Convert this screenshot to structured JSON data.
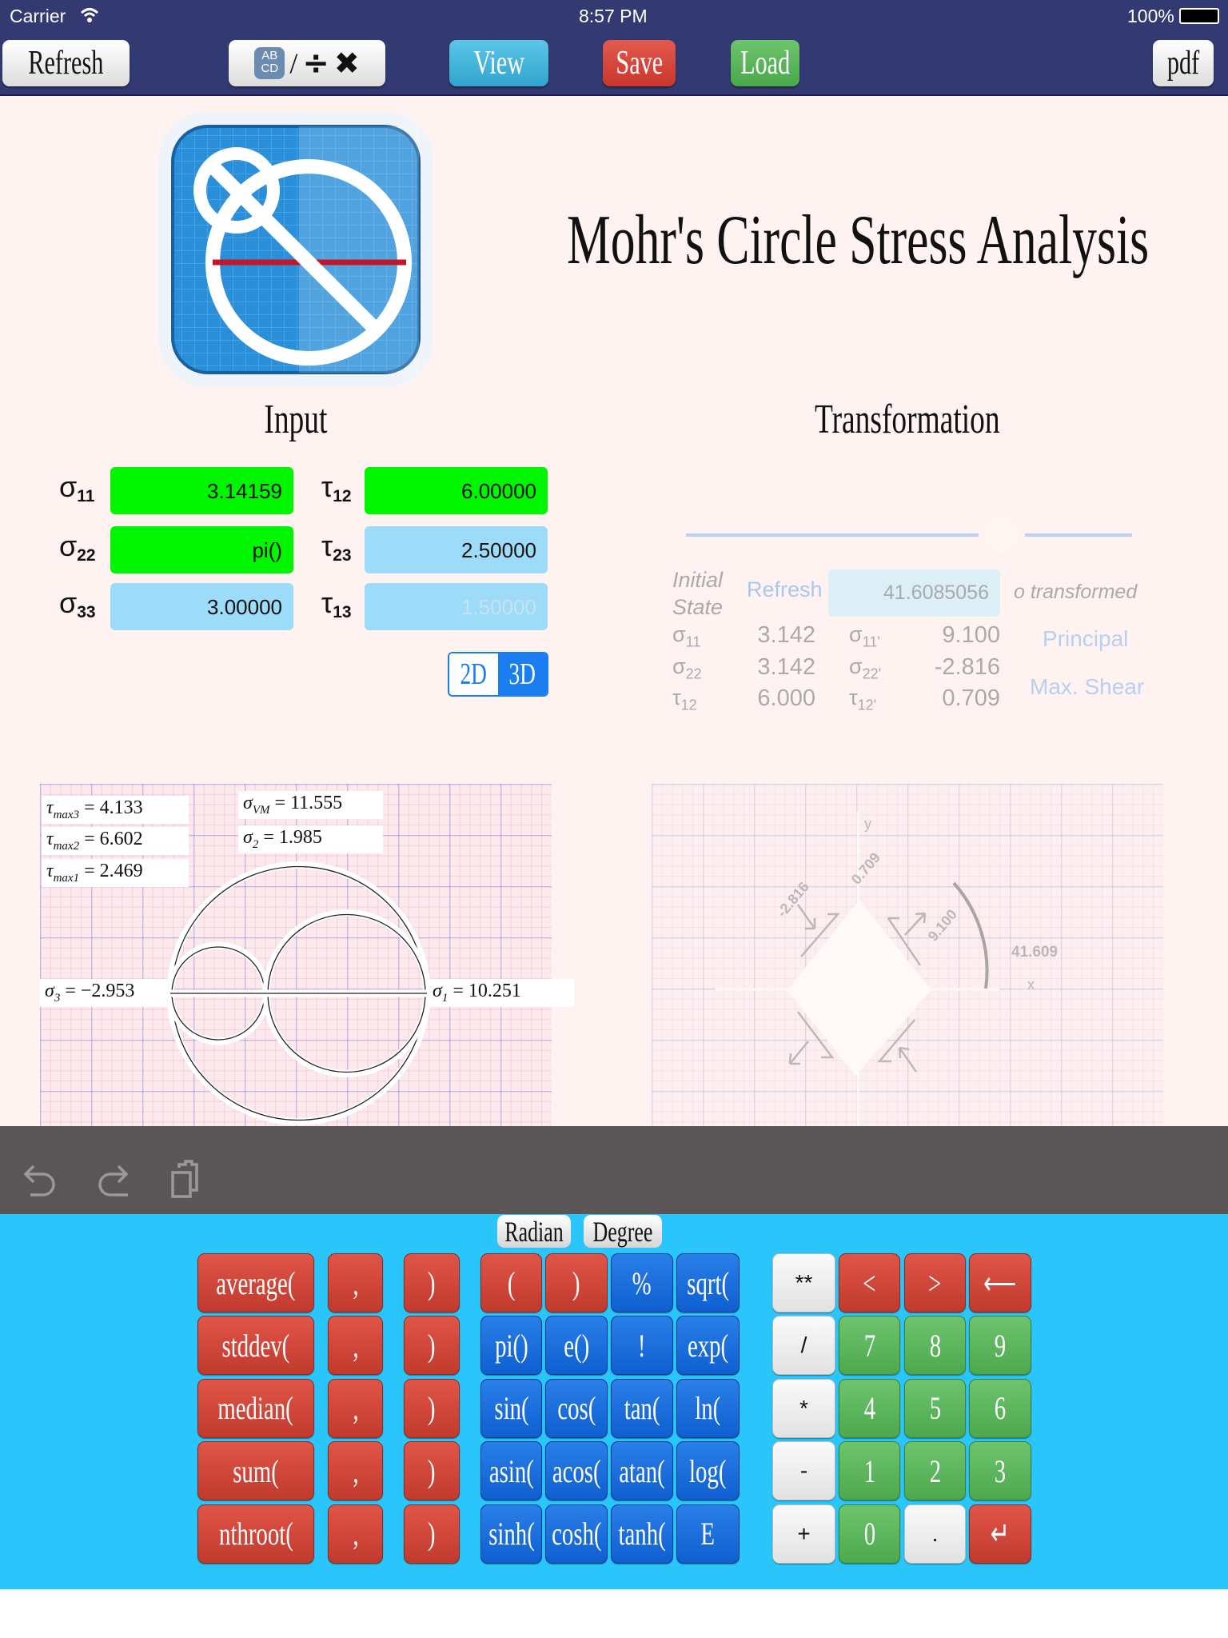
{
  "status_bar": {
    "carrier": "Carrier",
    "time": "8:57 PM",
    "battery": "100%"
  },
  "nav": {
    "refresh": "Refresh",
    "view": "View",
    "save": "Save",
    "load": "Load",
    "pdf": "pdf",
    "notation_icon_text": "AB CD"
  },
  "title": "Mohr's Circle Stress Analysis",
  "input": {
    "heading": "Input",
    "fields": [
      {
        "symbol": "σ",
        "sub": "11",
        "value": "3.14159"
      },
      {
        "symbol": "τ",
        "sub": "12",
        "value": "6.00000"
      },
      {
        "symbol": "σ",
        "sub": "22",
        "value": "pi()"
      },
      {
        "symbol": "τ",
        "sub": "23",
        "value": "2.50000"
      },
      {
        "symbol": "σ",
        "sub": "33",
        "value": "3.00000"
      },
      {
        "symbol": "τ",
        "sub": "13",
        "value": "1.50000"
      }
    ],
    "mode_2d": "2D",
    "mode_3d": "3D",
    "mode_selected": "3D"
  },
  "transformation": {
    "heading": "Transformation",
    "initial_state": "Initial State",
    "refresh": "Refresh",
    "angle_value": "41.6085056",
    "angle_suffix": "o transformed",
    "rows": [
      {
        "label": "σ",
        "sub": "11",
        "value": "3.142",
        "tlabel": "σ",
        "tsub": "11'",
        "tvalue": "9.100"
      },
      {
        "label": "σ",
        "sub": "22",
        "value": "3.142",
        "tlabel": "σ",
        "tsub": "22'",
        "tvalue": "-2.816"
      },
      {
        "label": "τ",
        "sub": "12",
        "value": "6.000",
        "tlabel": "τ",
        "tsub": "12'",
        "tvalue": "0.709"
      }
    ],
    "principal": "Principal",
    "max_shear": "Max. Shear"
  },
  "mohr": {
    "tau_max3": "4.133",
    "tau_max2": "6.602",
    "tau_max1": "2.469",
    "sigma_vm": "11.555",
    "sigma2": "1.985",
    "sigma3": "−2.953",
    "sigma1": "10.251",
    "principal_values": [
      -2.953,
      1.985,
      10.251
    ]
  },
  "element": {
    "y_axis": "y",
    "x_axis": "x",
    "sigma_x": "9.100",
    "sigma_y": "-2.816",
    "tau": "0.709",
    "angle": "41.609"
  },
  "keypad": {
    "radian": "Radian",
    "degree": "Degree",
    "rows": [
      [
        {
          "l": "average(",
          "c": "red"
        },
        {
          "l": ",",
          "c": "red"
        },
        {
          "l": ")",
          "c": "red"
        },
        {
          "l": "(",
          "c": "red"
        },
        {
          "l": ")",
          "c": "red"
        },
        {
          "l": "%",
          "c": "blue"
        },
        {
          "l": "sqrt(",
          "c": "blue"
        },
        {
          "l": "**",
          "c": "white"
        },
        {
          "l": "<",
          "c": "red"
        },
        {
          "l": ">",
          "c": "red"
        },
        {
          "l": "⟵",
          "c": "red"
        }
      ],
      [
        {
          "l": "stddev(",
          "c": "red"
        },
        {
          "l": ",",
          "c": "red"
        },
        {
          "l": ")",
          "c": "red"
        },
        {
          "l": "pi()",
          "c": "blue"
        },
        {
          "l": "e()",
          "c": "blue"
        },
        {
          "l": "!",
          "c": "blue"
        },
        {
          "l": "exp(",
          "c": "blue"
        },
        {
          "l": "/",
          "c": "white"
        },
        {
          "l": "7",
          "c": "green"
        },
        {
          "l": "8",
          "c": "green"
        },
        {
          "l": "9",
          "c": "green"
        }
      ],
      [
        {
          "l": "median(",
          "c": "red"
        },
        {
          "l": ",",
          "c": "red"
        },
        {
          "l": ")",
          "c": "red"
        },
        {
          "l": "sin(",
          "c": "blue"
        },
        {
          "l": "cos(",
          "c": "blue"
        },
        {
          "l": "tan(",
          "c": "blue"
        },
        {
          "l": "ln(",
          "c": "blue"
        },
        {
          "l": "*",
          "c": "white"
        },
        {
          "l": "4",
          "c": "green"
        },
        {
          "l": "5",
          "c": "green"
        },
        {
          "l": "6",
          "c": "green"
        }
      ],
      [
        {
          "l": "sum(",
          "c": "red"
        },
        {
          "l": ",",
          "c": "red"
        },
        {
          "l": ")",
          "c": "red"
        },
        {
          "l": "asin(",
          "c": "blue"
        },
        {
          "l": "acos(",
          "c": "blue"
        },
        {
          "l": "atan(",
          "c": "blue"
        },
        {
          "l": "log(",
          "c": "blue"
        },
        {
          "l": "-",
          "c": "white"
        },
        {
          "l": "1",
          "c": "green"
        },
        {
          "l": "2",
          "c": "green"
        },
        {
          "l": "3",
          "c": "green"
        }
      ],
      [
        {
          "l": "nthroot(",
          "c": "red"
        },
        {
          "l": ",",
          "c": "red"
        },
        {
          "l": ")",
          "c": "red"
        },
        {
          "l": "sinh(",
          "c": "blue"
        },
        {
          "l": "cosh(",
          "c": "blue"
        },
        {
          "l": "tanh(",
          "c": "blue"
        },
        {
          "l": "E",
          "c": "blue"
        },
        {
          "l": "+",
          "c": "white"
        },
        {
          "l": "0",
          "c": "green"
        },
        {
          "l": ".",
          "c": "white"
        },
        {
          "l": "↵",
          "c": "red"
        }
      ]
    ]
  },
  "toolbar": {
    "icons": [
      "undo-icon",
      "redo-icon",
      "paste-icon"
    ]
  }
}
